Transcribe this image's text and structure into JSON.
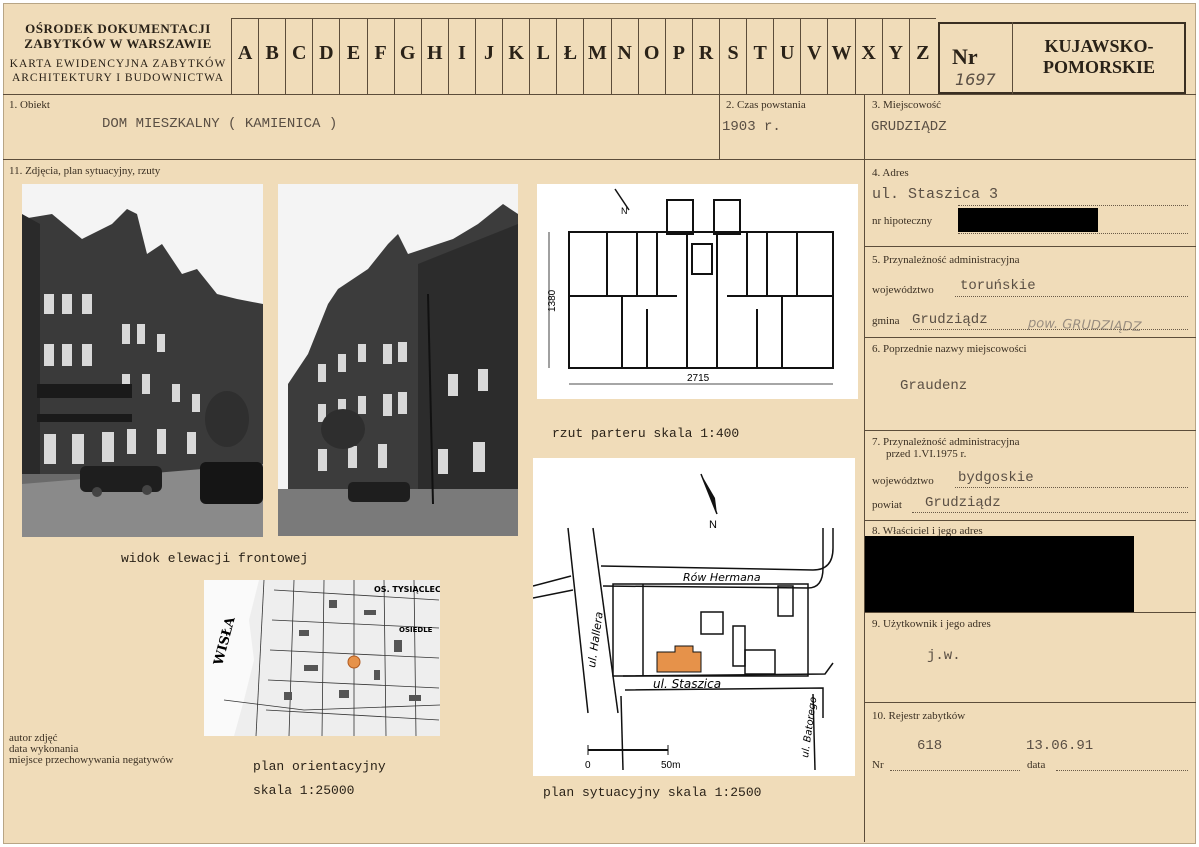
{
  "header": {
    "org_line1": "OŚRODEK DOKUMENTACJI",
    "org_line2": "ZABYTKÓW W WARSZAWIE",
    "sub_line1": "KARTA EWIDENCYJNA ZABYTKÓW",
    "sub_line2": "ARCHITEKTURY I BUDOWNICTWA",
    "letters": [
      "A",
      "B",
      "C",
      "D",
      "E",
      "F",
      "G",
      "H",
      "I",
      "J",
      "K",
      "L",
      "Ł",
      "M",
      "N",
      "O",
      "P",
      "R",
      "S",
      "T",
      "U",
      "V",
      "W",
      "X",
      "Y",
      "Z"
    ],
    "nr_label": "Nr",
    "nr_value": "1697",
    "region_line1": "KUJAWSKO-",
    "region_line2": "POMORSKIE"
  },
  "fields": {
    "obiekt_label": "1. Obiekt",
    "obiekt_value": "DOM MIESZKALNY ( KAMIENICA )",
    "czas_label": "2. Czas powstania",
    "czas_value": "1903 r.",
    "miejscowosc_label": "3. Miejscowość",
    "miejscowosc_value": "GRUDZIĄDZ",
    "zdjecia_label": "11. Zdjęcia, plan sytuacyjny, rzuty",
    "adres_label": "4. Adres",
    "adres_value": "ul. Staszica 3",
    "hipoteczny_label": "nr hipoteczny",
    "przyn_label": "5. Przynależność administracyjna",
    "woj_label": "województwo",
    "woj_value": "toruńskie",
    "gmina_label": "gmina",
    "gmina_value": "Grudziądz",
    "gmina_note": "pow. GRUDZIĄDZ",
    "poprz_label": "6. Poprzednie nazwy miejscowości",
    "poprz_value": "Graudenz",
    "przyn75_label_1": "7. Przynależność administracyjna",
    "przyn75_label_2": "przed 1.VI.1975 r.",
    "woj75_label": "województwo",
    "woj75_value": "bydgoskie",
    "powiat_label": "powiat",
    "powiat_value": "Grudziądz",
    "wlasciciel_label": "8. Właściciel i jego adres",
    "uzytkownik_label": "9. Użytkownik i jego adres",
    "uzytkownik_value": "j.w.",
    "rejestr_label": "10. Rejestr zabytków",
    "rejestr_nr_label": "Nr",
    "rejestr_nr_value": "618",
    "rejestr_data_label": "data",
    "rejestr_data_value": "13.06.91"
  },
  "captions": {
    "rzut": "rzut parteru  skala 1:400",
    "widok": "widok elewacji frontowej",
    "plan_orient_1": "plan orientacyjny",
    "plan_orient_2": "skala  1:25000",
    "plan_sytu": "plan sytuacyjny  skala 1:2500"
  },
  "footer_left": {
    "line1": "autor zdjęć",
    "line2": "data wykonania",
    "line3": "miejsce przechowywania negatywów"
  },
  "floorplan": {
    "dim_h": "1380",
    "dim_w": "2715",
    "north": "N"
  },
  "orient_map": {
    "river": "WISŁA",
    "os_label": "OS. TYSIĄCLECIA",
    "osiedle": "OSIEDLE"
  },
  "site_plan": {
    "street_top": "Rów Hermana",
    "street_left": "ul. Hallera",
    "street_main": "ul. Staszica",
    "street_right": "ul. Batorego",
    "scale_0": "0",
    "scale_50": "50m",
    "north": "N"
  }
}
